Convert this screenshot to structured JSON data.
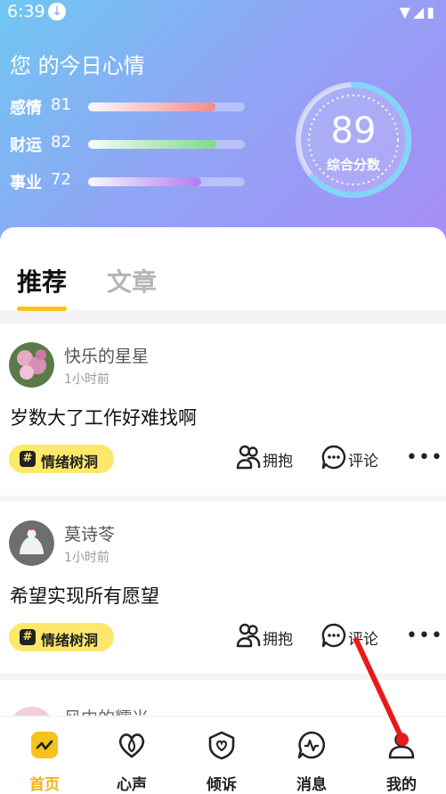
{
  "status_bar": {
    "time": "6:39",
    "download_icon": "download-icon",
    "system_icons": [
      "wifi-icon",
      "signal-icon",
      "battery-icon"
    ]
  },
  "mood": {
    "title": "您 的今日心情",
    "metrics": [
      {
        "label": "感情",
        "value": "81",
        "level": 0.81,
        "color": "#f58a8a"
      },
      {
        "label": "财运",
        "value": "82",
        "level": 0.82,
        "color": "#7ed88d"
      },
      {
        "label": "事业",
        "value": "72",
        "level": 0.72,
        "color": "#b07cf0"
      }
    ],
    "score": {
      "value": "89",
      "label": "综合分数"
    }
  },
  "tabs": [
    {
      "label": "推荐",
      "active": true
    },
    {
      "label": "文章",
      "active": false
    }
  ],
  "posts": [
    {
      "username": "快乐的星星",
      "time": "1小时前",
      "content": "岁数大了工作好难找啊",
      "tag": "情绪树洞",
      "hug": "拥抱",
      "comment": "评论"
    },
    {
      "username": "莫诗苓",
      "time": "1小时前",
      "content": "希望实现所有愿望",
      "tag": "情绪树洞",
      "hug": "拥抱",
      "comment": "评论"
    }
  ],
  "partial_post": {
    "username": "风中的糯米"
  },
  "nav": [
    {
      "label": "首页",
      "icon": "home-icon",
      "active": true
    },
    {
      "label": "心声",
      "icon": "heart-loop-icon",
      "active": false
    },
    {
      "label": "倾诉",
      "icon": "heart-shield-icon",
      "active": false
    },
    {
      "label": "消息",
      "icon": "message-pulse-icon",
      "active": false
    },
    {
      "label": "我的",
      "icon": "user-icon",
      "active": false
    }
  ],
  "colors": {
    "accent": "#f6c21c",
    "tag_bg": "#fce86a",
    "annotation_arrow": "#e81a1a"
  }
}
